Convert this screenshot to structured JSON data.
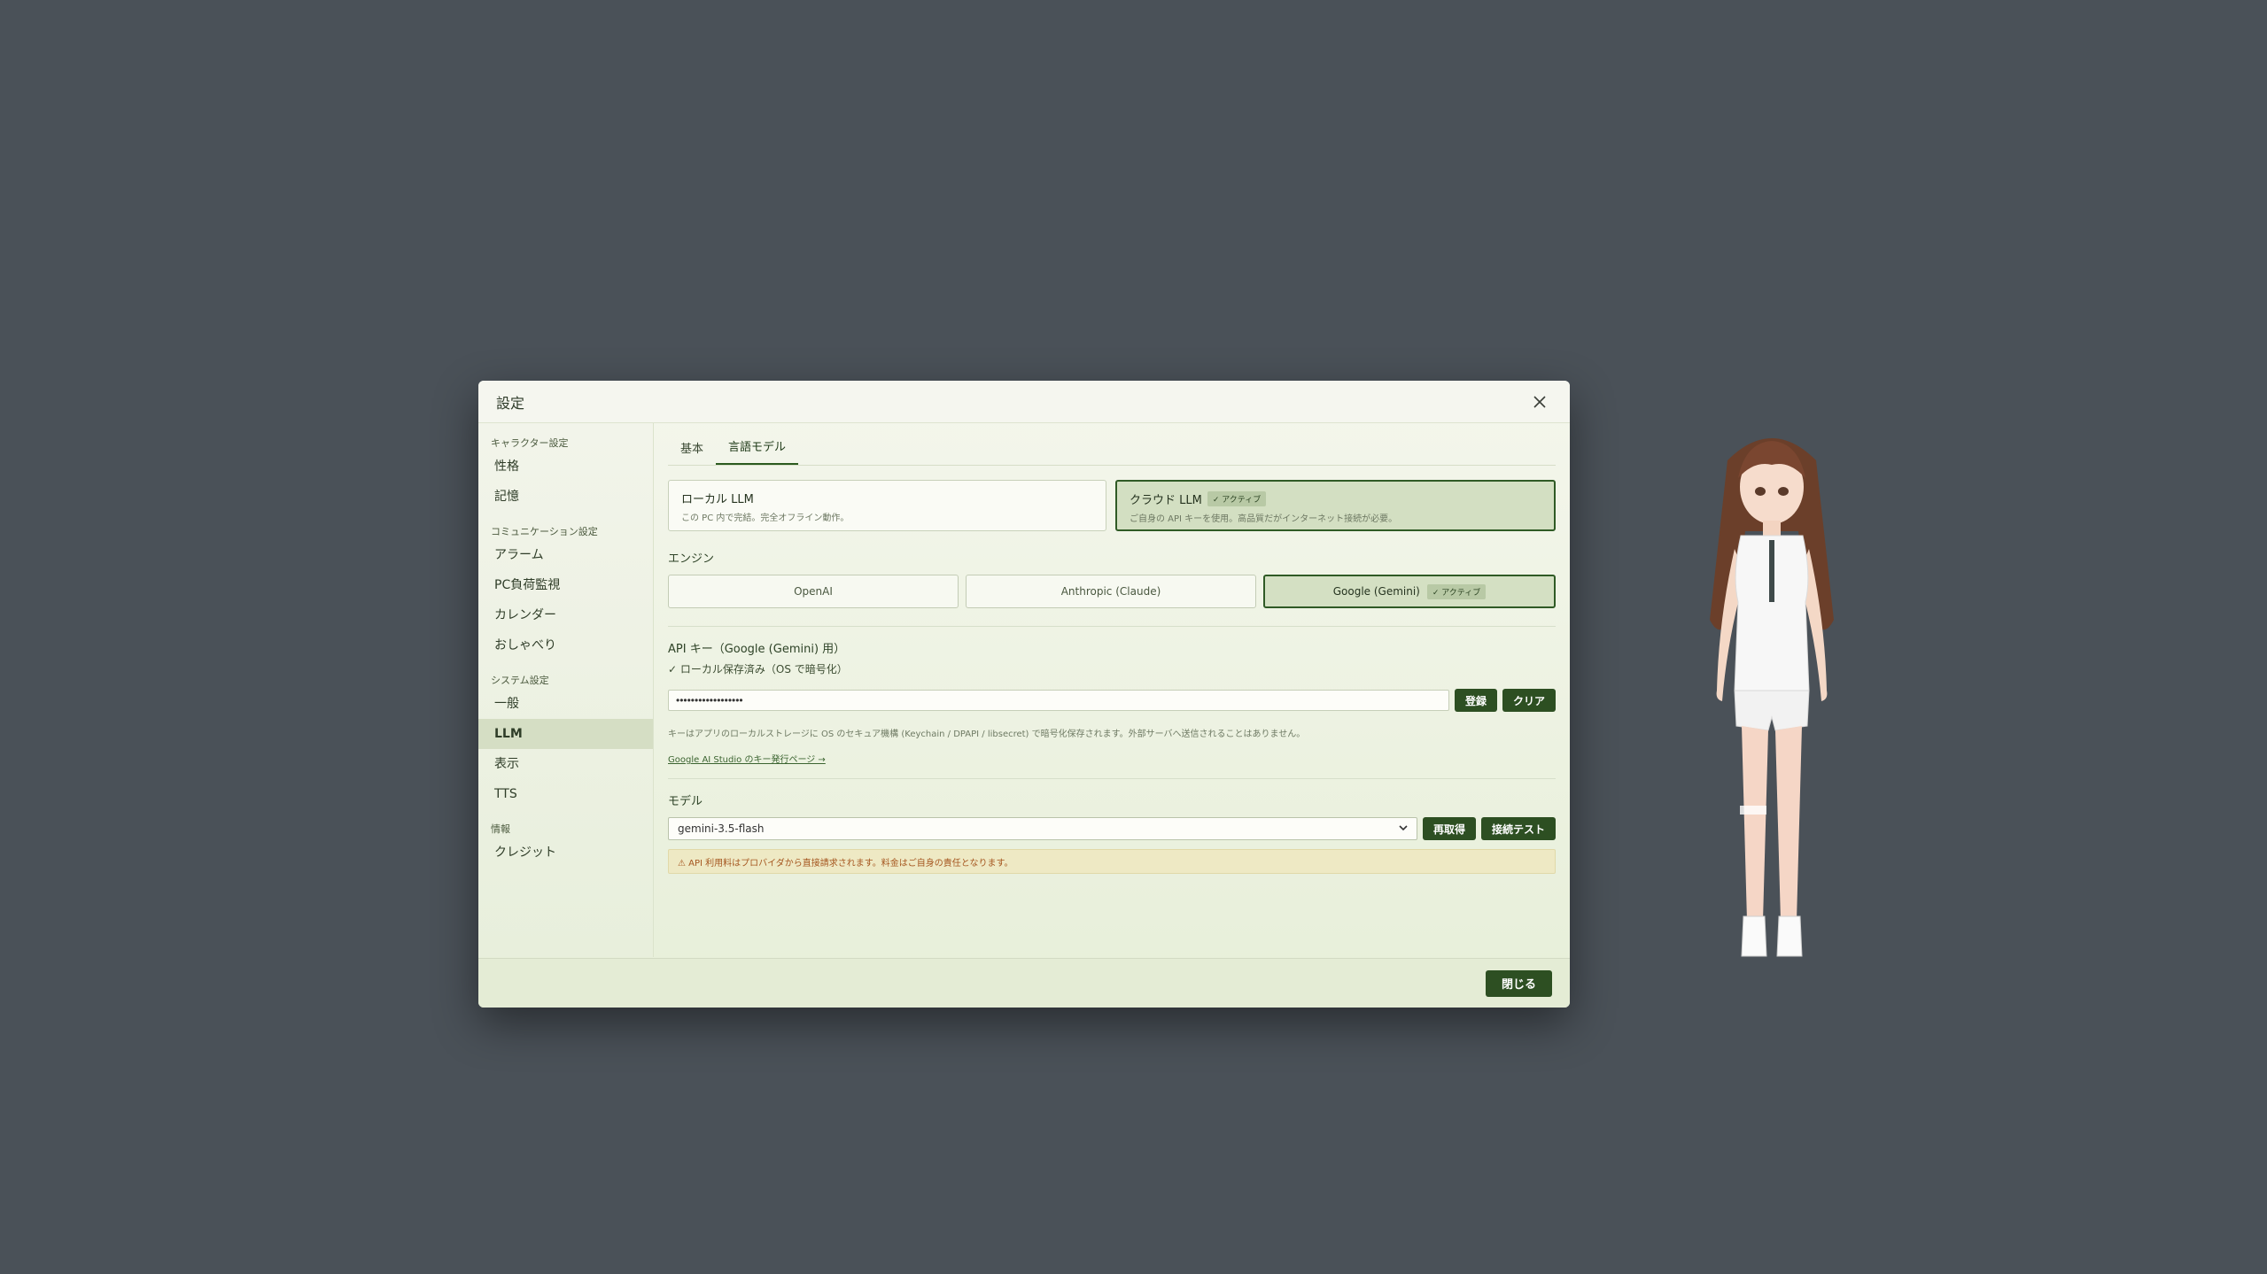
{
  "dialog": {
    "title": "設定",
    "close_icon": "close-icon"
  },
  "sidebar": {
    "groups": [
      {
        "label": "キャラクター設定",
        "items": [
          "性格",
          "記憶"
        ]
      },
      {
        "label": "コミュニケーション設定",
        "items": [
          "アラーム",
          "PC負荷監視",
          "カレンダー",
          "おしゃべり"
        ]
      },
      {
        "label": "システム設定",
        "items": [
          "一般",
          "LLM",
          "表示",
          "TTS"
        ]
      },
      {
        "label": "情報",
        "items": [
          "クレジット"
        ]
      }
    ],
    "active_item": "LLM"
  },
  "tabs": [
    {
      "label": "基本",
      "active": false
    },
    {
      "label": "言語モデル",
      "active": true
    }
  ],
  "llm_type": {
    "local": {
      "title": "ローカル LLM",
      "desc": "この PC 内で完結。完全オフライン動作。"
    },
    "cloud": {
      "title": "クラウド LLM",
      "badge": "✓ アクティブ",
      "desc": "ご自身の API キーを使用。高品質だがインターネット接続が必要。"
    }
  },
  "engine": {
    "label": "エンジン",
    "options": [
      {
        "label": "OpenAI"
      },
      {
        "label": "Anthropic (Claude)"
      },
      {
        "label": "Google (Gemini)",
        "badge": "✓ アクティブ"
      }
    ]
  },
  "api_key": {
    "label": "API キー（Google (Gemini) 用）",
    "status": "✓ ローカル保存済み（OS で暗号化）",
    "value": "••••••••••••••••••",
    "register_label": "登録",
    "clear_label": "クリア",
    "note": "キーはアプリのローカルストレージに OS のセキュア機構 (Keychain / DPAPI / libsecret) で暗号化保存されます。外部サーバへ送信されることはありません。",
    "link": "Google AI Studio のキー発行ページ →"
  },
  "model": {
    "label": "モデル",
    "selected": "gemini-3.5-flash",
    "refetch_label": "再取得",
    "test_label": "接続テスト",
    "warning": "⚠ API 利用料はプロバイダから直接請求されます。料金はご自身の責任となります。"
  },
  "footer": {
    "close_label": "閉じる"
  },
  "colors": {
    "accent": "#2d4f22",
    "background": "#4a5158",
    "warning": "#a5561f"
  }
}
